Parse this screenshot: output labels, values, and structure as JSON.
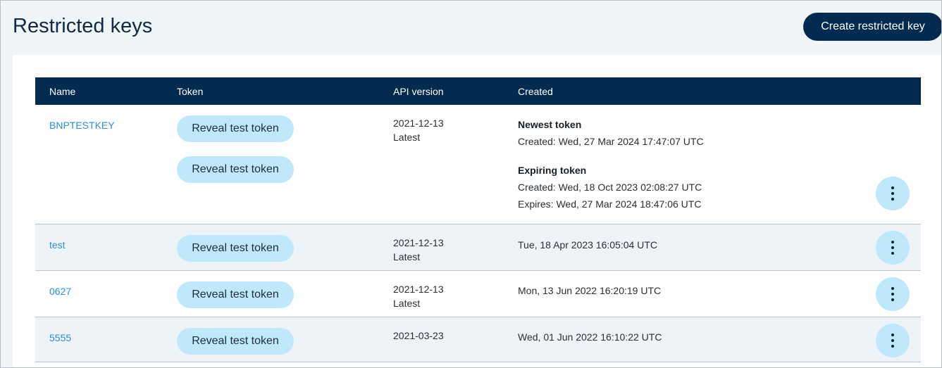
{
  "page": {
    "title": "Restricted keys",
    "create_button": "Create restricted key"
  },
  "table": {
    "headers": [
      "Name",
      "Token",
      "API version",
      "Created"
    ],
    "rows": [
      {
        "name": "BNPTESTKEY",
        "tokens": [
          "Reveal test token",
          "Reveal test token"
        ],
        "api_version": "2021-12-13",
        "api_tag": "Latest",
        "created": {
          "newest_label": "Newest token",
          "newest_created": "Created: Wed, 27 Mar 2024 17:47:07 UTC",
          "expiring_label": "Expiring token",
          "expiring_created": "Created: Wed, 18 Oct 2023 02:08:27 UTC",
          "expiring_expires": "Expires: Wed, 27 Mar 2024 18:47:06 UTC"
        }
      },
      {
        "name": "test",
        "tokens": [
          "Reveal test token"
        ],
        "api_version": "2021-12-13",
        "api_tag": "Latest",
        "created": "Tue, 18 Apr 2023 16:05:04 UTC"
      },
      {
        "name": "0627",
        "tokens": [
          "Reveal test token"
        ],
        "api_version": "2021-12-13",
        "api_tag": "Latest",
        "created": "Mon, 13 Jun 2022 16:20:19 UTC"
      },
      {
        "name": "5555",
        "tokens": [
          "Reveal test token"
        ],
        "api_version": "2021-03-23",
        "created": "Wed, 01 Jun 2022 16:10:22 UTC"
      }
    ]
  },
  "icons": {
    "row_menu": "more-vertical-icon"
  },
  "colors": {
    "header_bg": "#022b4f",
    "reveal_bg": "#bfe8fb",
    "link": "#2a8fd0"
  }
}
